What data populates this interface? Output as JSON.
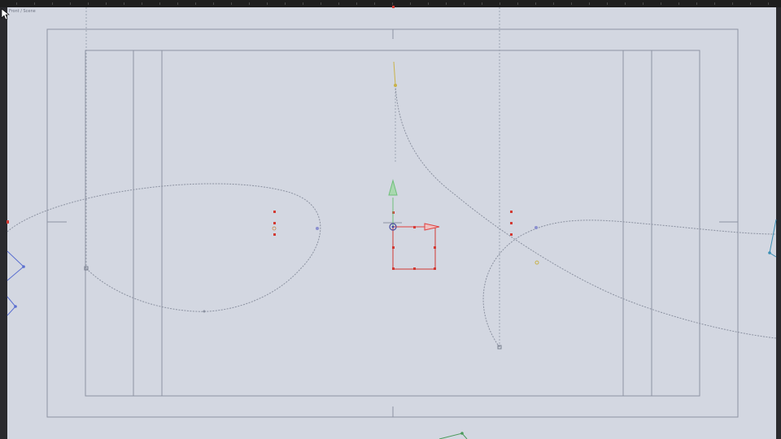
{
  "viewport": {
    "label": "Front / Scene"
  },
  "colors": {
    "background": "#d3d7e1",
    "frame_line": "#8d93a3",
    "guide_line": "#9ea4b2",
    "curve": "#8b91a0",
    "handle_red": "#d23a33",
    "axis_x": "#e04040",
    "axis_y": "#6fbf7a",
    "gizmo_center": "#4a4fa0",
    "vertex_blue": "#5a6fd0",
    "vertex_yellow": "#c8b24a",
    "teal_vertex": "#3b8fb5"
  },
  "icons": {
    "cursor": "mouse-pointer-icon",
    "move_gizmo": "transform-gizmo-icon"
  }
}
